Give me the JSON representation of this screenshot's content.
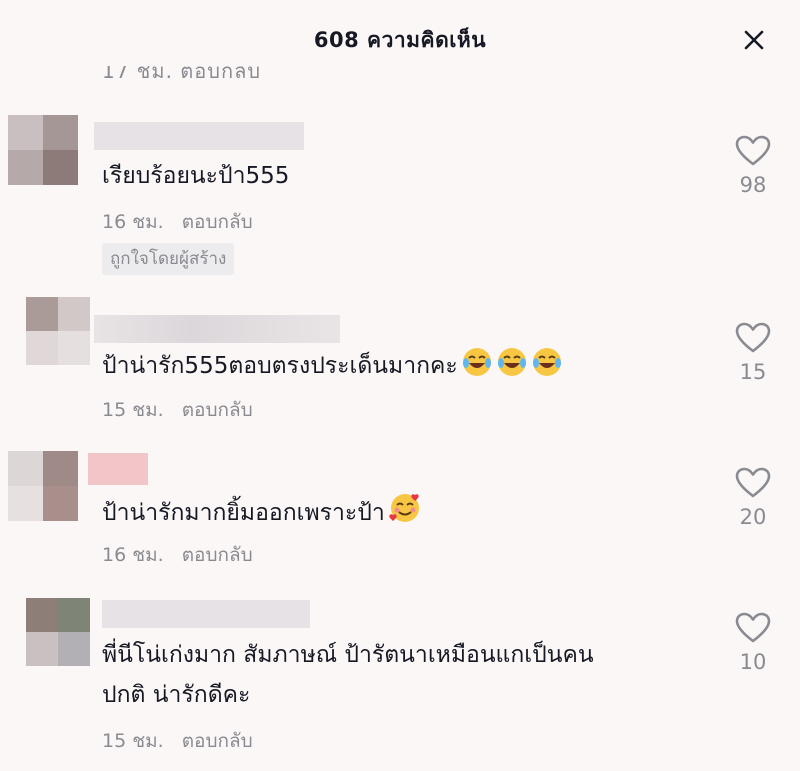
{
  "header": {
    "title": "608 ความคิดเห็น",
    "close_icon": "close-icon"
  },
  "clipped_previous": {
    "text": "17 ชม.  ตอบกลับ"
  },
  "comments": [
    {
      "text": "เรียบร้อยนะป้า555",
      "time": "16 ชม.",
      "reply": "ตอบกลับ",
      "badge": "ถูกใจโดยผู้สร้าง",
      "likes": "98",
      "emojis": []
    },
    {
      "text": "ป้าน่ารัก555ตอบตรงประเด็นมากคะ",
      "time": "15 ชม.",
      "reply": "ตอบกลับ",
      "likes": "15",
      "emojis": [
        "face-with-tears-of-joy",
        "face-with-tears-of-joy",
        "face-with-tears-of-joy"
      ]
    },
    {
      "text": "ป้าน่ารักมากยิ้มออกเพราะป้า",
      "time": "16 ชม.",
      "reply": "ตอบกลับ",
      "likes": "20",
      "emojis": [
        "smiling-face-with-hearts"
      ]
    },
    {
      "text_line1": "พี่นีโน่เก่งมาก  สัมภาษณ์ ป้ารัตนาเหมือนแกเป็นคน",
      "text_line2": "ปกติ  น่ารักดีคะ",
      "time": "15 ชม.",
      "reply": "ตอบกลับ",
      "likes": "10",
      "emojis": []
    }
  ],
  "colors": {
    "text": "#161823",
    "muted": "#8a8b91",
    "background": "#fbf7f7",
    "badge_bg": "#ecebee"
  }
}
